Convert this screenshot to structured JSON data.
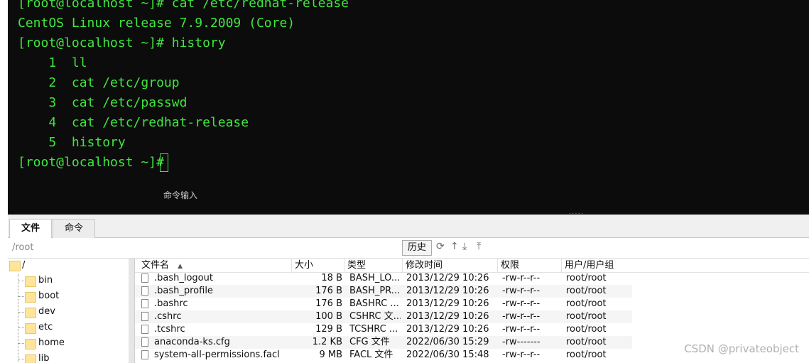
{
  "terminal": {
    "lines": [
      "[root@localhost ~]# cat /etc/redhat-release",
      "CentOS Linux release 7.9.2009 (Core)",
      "[root@localhost ~]# history",
      "    1  ll",
      "    2  cat /etc/group",
      "    3  cat /etc/passwd",
      "    4  cat /etc/redhat-release",
      "    5  history",
      "[root@localhost ~]# "
    ],
    "command_hint": "命令输入",
    "text_color": "#3fe63f",
    "background": "#0c0c0c"
  },
  "tabs": [
    {
      "label": "文件",
      "active": true
    },
    {
      "label": "命令",
      "active": false
    }
  ],
  "pathbar": {
    "path": "/root",
    "history_label": "历史",
    "icons": [
      "refresh-icon",
      "up-icon",
      "download-icon",
      "upload-icon"
    ]
  },
  "tree": {
    "root": "/",
    "items": [
      "bin",
      "boot",
      "dev",
      "etc",
      "home",
      "lib"
    ]
  },
  "filelist": {
    "columns": [
      "文件名",
      "大小",
      "类型",
      "修改时间",
      "权限",
      "用户/用户组"
    ],
    "sort_indicator": "▲",
    "rows": [
      {
        "name": ".bash_logout",
        "size": "18 B",
        "type": "BASH_LO...",
        "mtime": "2013/12/29 10:26",
        "perm": "-rw-r--r--",
        "owner": "root/root"
      },
      {
        "name": ".bash_profile",
        "size": "176 B",
        "type": "BASH_PR...",
        "mtime": "2013/12/29 10:26",
        "perm": "-rw-r--r--",
        "owner": "root/root"
      },
      {
        "name": ".bashrc",
        "size": "176 B",
        "type": "BASHRC ...",
        "mtime": "2013/12/29 10:26",
        "perm": "-rw-r--r--",
        "owner": "root/root"
      },
      {
        "name": ".cshrc",
        "size": "100 B",
        "type": "CSHRC 文...",
        "mtime": "2013/12/29 10:26",
        "perm": "-rw-r--r--",
        "owner": "root/root"
      },
      {
        "name": ".tcshrc",
        "size": "129 B",
        "type": "TCSHRC ...",
        "mtime": "2013/12/29 10:26",
        "perm": "-rw-r--r--",
        "owner": "root/root"
      },
      {
        "name": "anaconda-ks.cfg",
        "size": "1.2 KB",
        "type": "CFG 文件",
        "mtime": "2022/06/30 15:29",
        "perm": "-rw-------",
        "owner": "root/root"
      },
      {
        "name": "system-all-permissions.facl",
        "size": "9 MB",
        "type": "FACL 文件",
        "mtime": "2022/06/30 15:48",
        "perm": "-rw-r--r--",
        "owner": "root/root"
      }
    ]
  },
  "watermark": "CSDN @privateobject"
}
